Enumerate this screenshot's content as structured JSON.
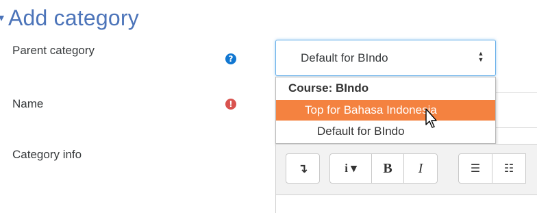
{
  "heading": {
    "chevron": "▾",
    "title": "Add category"
  },
  "fields": {
    "parent_label": "Parent category",
    "name_label": "Name",
    "info_label": "Category info"
  },
  "icons": {
    "help_glyph": "?",
    "required_glyph": "!",
    "help_color": "#1177d1",
    "required_color": "#d9534f"
  },
  "parent_select": {
    "selected": "Default for BIndo",
    "arrows": "▲▼"
  },
  "dropdown": {
    "group_label": "Course: BIndo",
    "options": [
      "Top for Bahasa Indonesia",
      "Default for BIndo"
    ],
    "highlight_color": "#f48240"
  },
  "toolbar": {
    "collapse": "↴",
    "info": "i ▾",
    "bold": "B",
    "italic": "I",
    "unordered_list": "☰",
    "ordered_list": "☷"
  },
  "colors": {
    "accent": "#4c74b9"
  }
}
